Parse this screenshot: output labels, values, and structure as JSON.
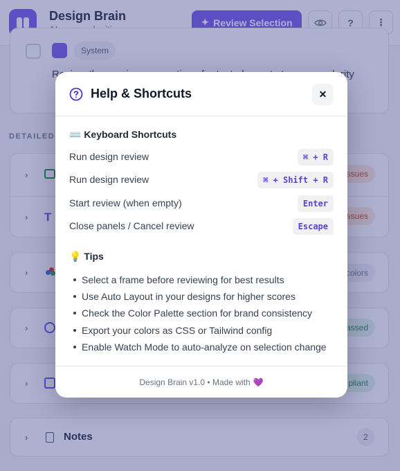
{
  "header": {
    "title": "Design Brain",
    "subtitle": "AI-powered critique",
    "review_label": "Review Selection",
    "help_label": "?",
    "more_label": "⋮"
  },
  "background": {
    "system_tag": "System",
    "system_text": "Review the naming conventions for text elements to ensure clarity",
    "section_label": "DETAILED",
    "rows": [
      {
        "badge": "issues"
      },
      {
        "badge": "issues"
      },
      {
        "badge": "colors"
      },
      {
        "badge": "assed"
      },
      {
        "badge": "pliant"
      }
    ],
    "notes_label": "Notes",
    "notes_count": "2"
  },
  "modal": {
    "title": "Help & Shortcuts",
    "close_label": "✕",
    "shortcuts_title": "⌨️ Keyboard Shortcuts",
    "shortcuts": [
      {
        "label": "Run design review",
        "keys": "⌘ + R"
      },
      {
        "label": "Run design review",
        "keys": "⌘ + Shift + R"
      },
      {
        "label": "Start review (when empty)",
        "keys": "Enter"
      },
      {
        "label": "Close panels / Cancel review",
        "keys": "Escape"
      }
    ],
    "tips_title": "💡 Tips",
    "tips": [
      "Select a frame before reviewing for best results",
      "Use Auto Layout in your designs for higher scores",
      "Check the Color Palette section for brand consistency",
      "Export your colors as CSS or Tailwind config",
      "Enable Watch Mode to auto-analyze on selection change"
    ],
    "footer": "Design Brain v1.0 • Made with",
    "footer_heart": "💜"
  },
  "colors": {
    "accent": "#6d4ee8",
    "overlay": "#8f93c4",
    "issues_badge": "#fde7d6",
    "passed_badge": "#dcf5e4"
  }
}
